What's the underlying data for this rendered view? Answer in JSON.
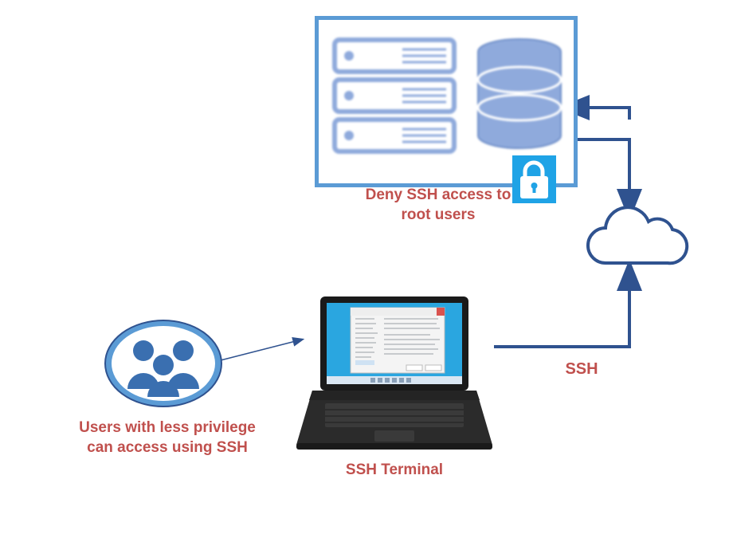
{
  "labels": {
    "server_caption": "Deny SSH access to root users",
    "users_caption": "Users with less privilege can access using SSH",
    "laptop_caption": "SSH Terminal",
    "ssh_link": "SSH"
  },
  "icons": {
    "server": "server-rack-icon",
    "database": "database-icon",
    "lock": "lock-icon",
    "cloud": "cloud-icon",
    "users": "users-icon",
    "laptop": "laptop-icon"
  },
  "colors": {
    "label": "#c0504d",
    "border": "#5b9bd5",
    "icon": "#8faadc",
    "arrow": "#2f528f",
    "lock_bg": "#1fa3e6"
  }
}
